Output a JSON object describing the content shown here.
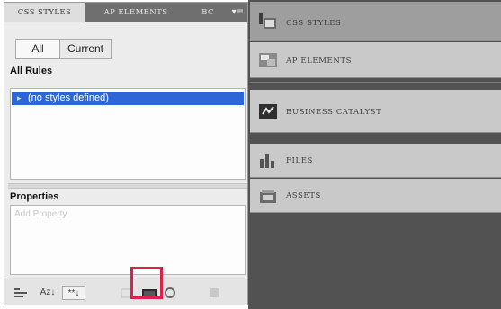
{
  "left_panel": {
    "tabs": [
      "CSS STYLES",
      "AP ELEMENTS",
      "BC"
    ],
    "tab_menu_icon": "panel-menu-icon",
    "mode_buttons": {
      "all": "All",
      "current": "Current"
    },
    "all_rules_label": "All Rules",
    "rules": [
      {
        "label": "(no styles defined)",
        "selected": true
      }
    ],
    "properties_label": "Properties",
    "properties_row": "Add Property",
    "toolbar": [
      {
        "name": "show-category-view-icon",
        "label": ""
      },
      {
        "name": "show-list-view-icon",
        "label": "Az↓"
      },
      {
        "name": "show-only-set-properties-icon",
        "label": "**↓"
      },
      {
        "name": "attach-style-sheet-icon",
        "label": ""
      },
      {
        "name": "new-css-rule-icon",
        "label": ""
      },
      {
        "name": "edit-rule-icon",
        "label": ""
      },
      {
        "name": "delete-rule-icon",
        "label": ""
      }
    ],
    "highlight_color": "#e0204a",
    "selection_color": "#2c66d8"
  },
  "right_panel": {
    "items": [
      {
        "label": "CSS STYLES",
        "icon": "css-styles-icon",
        "active": true
      },
      {
        "label": "AP ELEMENTS",
        "icon": "ap-elements-icon",
        "active": false
      },
      {
        "label": "BUSINESS CATALYST",
        "icon": "business-catalyst-icon",
        "active": false
      },
      {
        "label": "FILES",
        "icon": "files-icon",
        "active": false
      },
      {
        "label": "ASSETS",
        "icon": "assets-icon",
        "active": false
      }
    ]
  }
}
